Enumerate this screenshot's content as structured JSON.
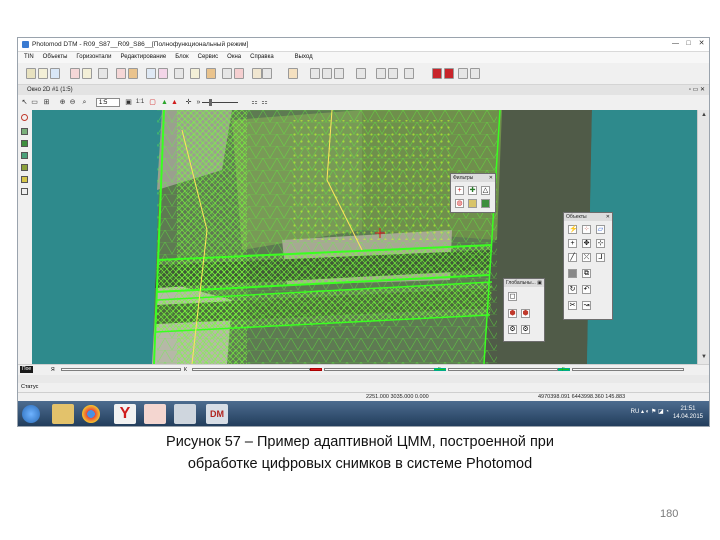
{
  "window": {
    "title": "Photomod DTM - R09_S87__R09_S86__[Полнофункциональный режим]",
    "min": "—",
    "max": "□",
    "close": "✕"
  },
  "menu": [
    "TIN",
    "Объекты",
    "Горизонтали",
    "Редактирование",
    "Блок",
    "Сервис",
    "Окна",
    "Справка",
    "Выход"
  ],
  "view": {
    "title": "Окно 2D #1 (1:5)",
    "zoom": "1:5",
    "zoom_label": "1:1"
  },
  "palettes": {
    "filters": "Фильтры",
    "objects": "Объекты",
    "global": "Глобальны..."
  },
  "rowbar": {
    "tag": "Пое",
    "letter_a": "Я",
    "letter_k": "К",
    "letter_g": "Г",
    "letter_g2": "Г"
  },
  "status": {
    "label": "Статус",
    "coords_left": "2251.000 3035.000 0.000",
    "coords_right": "4970398.091 6443998.360 145.883"
  },
  "taskbar": {
    "lang": "RU",
    "time": "21:51",
    "date": "14.04.2015",
    "dm_label": "DM"
  },
  "colors": {
    "accent_red": "#e0161f",
    "accent_green": "#19c21b",
    "mesh_green": "#5cff3a",
    "teal": "#2e8a8c"
  },
  "caption": {
    "line1": "Рисунок 57 – Пример адаптивной ЦММ, построенной при",
    "line2": "обработке цифровых снимков в системе Photomod"
  },
  "page_number": "180"
}
